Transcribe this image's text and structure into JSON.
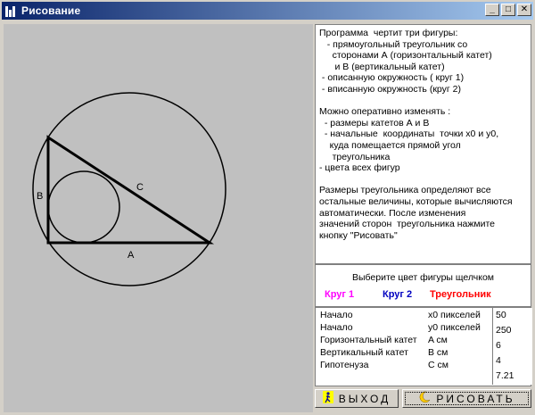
{
  "window": {
    "title": "Рисование",
    "minimize": "_",
    "maximize": "□",
    "close": "✕"
  },
  "canvas": {
    "labels": {
      "a": "A",
      "b": "B",
      "c": "C"
    }
  },
  "info": {
    "text": "Программа  чертит три фигуры:\n   - прямоугольный треугольник со\n     сторонами А (горизонтальный катет)\n      и В (вертикальный катет)\n - описанную окружность ( круг 1)\n - вписанную окружность (круг 2)\n\nМожно оперативно изменять :\n  - размеры катетов А и В\n  - начальные  координаты  точки x0 и y0,\n    куда помещается прямой угол\n     треугольника\n- цвета всех фигур\n\nРазмеры треугольника определяют все\nостальные величины, которые вычисляются\nавтоматически. После изменения\nзначений сторон  треугольника нажмите\nкнопку \"Рисовать\""
  },
  "colors": {
    "prompt": "Выберите цвет фигуры щелчком",
    "circle1": {
      "label": "Круг 1",
      "color": "#ff00ff"
    },
    "circle2": {
      "label": "Круг 2",
      "color": "#0000c0"
    },
    "triangle": {
      "label": "Треугольник",
      "color": "#ff0000"
    }
  },
  "params": [
    {
      "label": "Начало",
      "unit": "x0 пикселей",
      "value": "50"
    },
    {
      "label": "Начало",
      "unit": "y0 пикселей",
      "value": "250"
    },
    {
      "label": "Горизонтальный катет",
      "unit": "A см",
      "value": "6"
    },
    {
      "label": "Вертикальный катет",
      "unit": "B см",
      "value": "4"
    },
    {
      "label": "Гипотенуза",
      "unit": " C см",
      "value": "7.21"
    }
  ],
  "buttons": {
    "exit": "ВЫХОД",
    "draw": "РИСОВАТЬ"
  }
}
